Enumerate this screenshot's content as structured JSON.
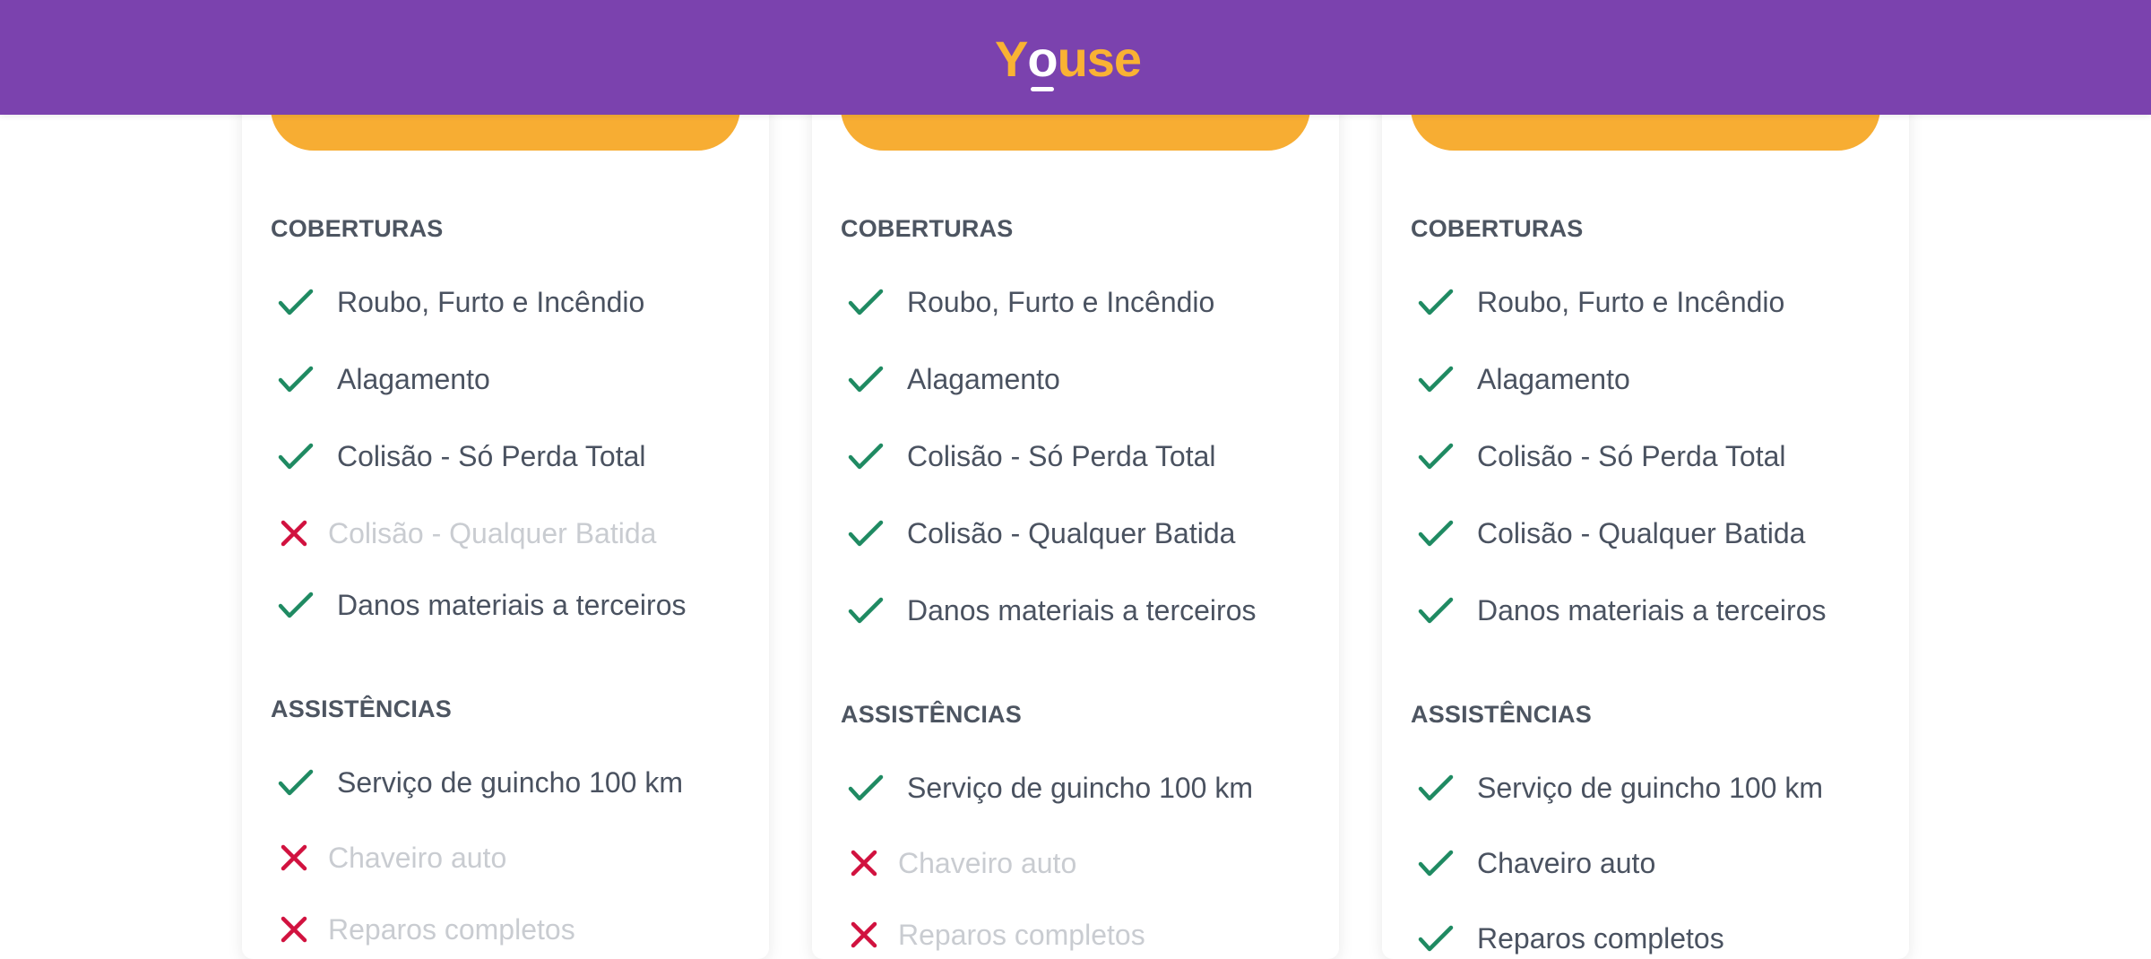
{
  "header": {
    "logo_text": "youse",
    "logo_part1": "Y",
    "logo_part2": "o",
    "logo_part3": "use",
    "background": "#7b42ae",
    "logo_color": "#f9b233"
  },
  "colors": {
    "check": "#1f8a62",
    "cross": "#d1123f",
    "cta": "#f7ad33",
    "included_text": "#4a5260",
    "excluded_text": "#c9ccd1"
  },
  "plans": [
    {
      "coberturas_title": "COBERTURAS",
      "coberturas": [
        {
          "label": "Roubo, Furto e Incêndio",
          "included": true
        },
        {
          "label": "Alagamento",
          "included": true
        },
        {
          "label": "Colisão - Só Perda Total",
          "included": true
        },
        {
          "label": "Colisão - Qualquer Batida",
          "included": false
        },
        {
          "label": "Danos materiais a terceiros",
          "included": true
        }
      ],
      "assistencias_title": "ASSISTÊNCIAS",
      "assistencias": [
        {
          "label": "Serviço de guincho 100 km",
          "included": true
        },
        {
          "label": "Chaveiro auto",
          "included": false
        },
        {
          "label": "Reparos completos",
          "included": false
        }
      ]
    },
    {
      "coberturas_title": "COBERTURAS",
      "coberturas": [
        {
          "label": "Roubo, Furto e Incêndio",
          "included": true
        },
        {
          "label": "Alagamento",
          "included": true
        },
        {
          "label": "Colisão - Só Perda Total",
          "included": true
        },
        {
          "label": "Colisão - Qualquer Batida",
          "included": true
        },
        {
          "label": "Danos materiais a terceiros",
          "included": true
        }
      ],
      "assistencias_title": "ASSISTÊNCIAS",
      "assistencias": [
        {
          "label": "Serviço de guincho 100 km",
          "included": true
        },
        {
          "label": "Chaveiro auto",
          "included": false
        },
        {
          "label": "Reparos completos",
          "included": false
        }
      ]
    },
    {
      "coberturas_title": "COBERTURAS",
      "coberturas": [
        {
          "label": "Roubo, Furto e Incêndio",
          "included": true
        },
        {
          "label": "Alagamento",
          "included": true
        },
        {
          "label": "Colisão - Só Perda Total",
          "included": true
        },
        {
          "label": "Colisão - Qualquer Batida",
          "included": true
        },
        {
          "label": "Danos materiais a terceiros",
          "included": true
        }
      ],
      "assistencias_title": "ASSISTÊNCIAS",
      "assistencias": [
        {
          "label": "Serviço de guincho 100 km",
          "included": true
        },
        {
          "label": "Chaveiro auto",
          "included": true
        },
        {
          "label": "Reparos completos",
          "included": true
        }
      ]
    }
  ]
}
